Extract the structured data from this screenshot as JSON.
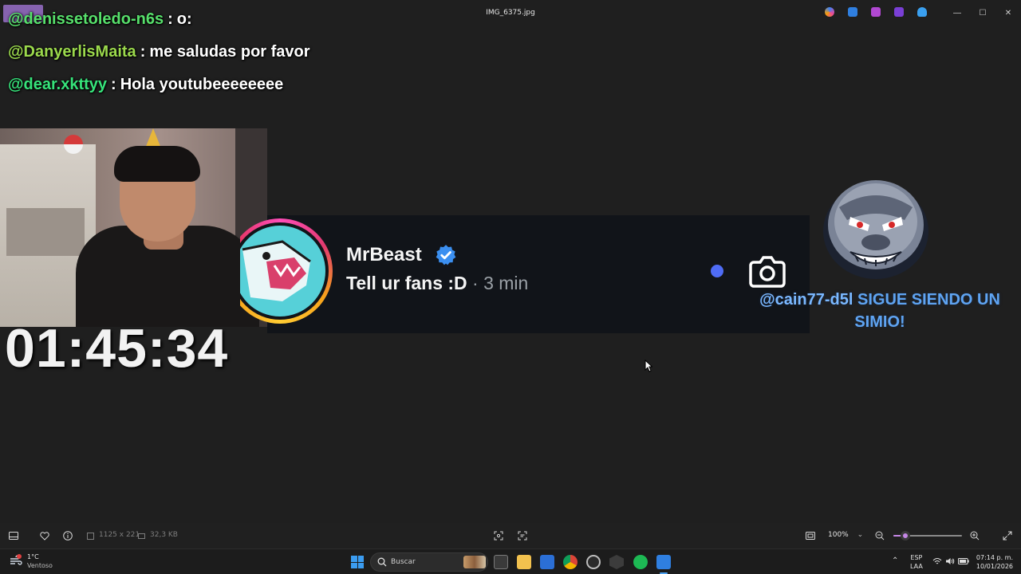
{
  "window": {
    "title": "IMG_6375.jpg",
    "controls": {
      "minimize": "—",
      "maximize": "☐",
      "close": "✕"
    }
  },
  "chat": [
    {
      "user": "@denissetoledo-n6s",
      "sep": ":",
      "message": "o:"
    },
    {
      "user": "@DanyerlisMaita",
      "sep": ":",
      "message": "me saludas por favor"
    },
    {
      "user": "@dear.xkttyy",
      "sep": ":",
      "message": "Hola youtubeeeeeeee"
    }
  ],
  "timer": "01:45:34",
  "notification": {
    "name": "MrBeast",
    "message": "Tell ur fans :D",
    "time": "· 3 min",
    "icons": [
      "verified-badge-icon",
      "camera-icon"
    ],
    "colors": {
      "card_bg": "#111419",
      "dot": "#4f6cf5",
      "verified": "#3b8ff0"
    }
  },
  "alert": {
    "user": "@cain77-d5l",
    "message": "SIGUE SIENDO UN SIMIO!"
  },
  "photo_toolbar": {
    "dimensions": "1125 x 221",
    "file_size": "32,3 KB",
    "zoom": "100%",
    "zoom_fraction": 0.18,
    "icons": [
      "filmstrip-icon",
      "favorite-heart-icon",
      "info-icon",
      "crop-select-icon",
      "text-scan-icon",
      "fit-screen-icon",
      "zoom-out-icon",
      "zoom-in-icon",
      "expand-icon"
    ]
  },
  "taskbar": {
    "weather_temp": "1°C",
    "weather_desc": "Ventoso",
    "weather_badge": "2",
    "search_placeholder": "Buscar",
    "lang_top": "ESP",
    "lang_bottom": "LAA",
    "time": "07:14 p. m.",
    "date": "10/01/2026"
  }
}
